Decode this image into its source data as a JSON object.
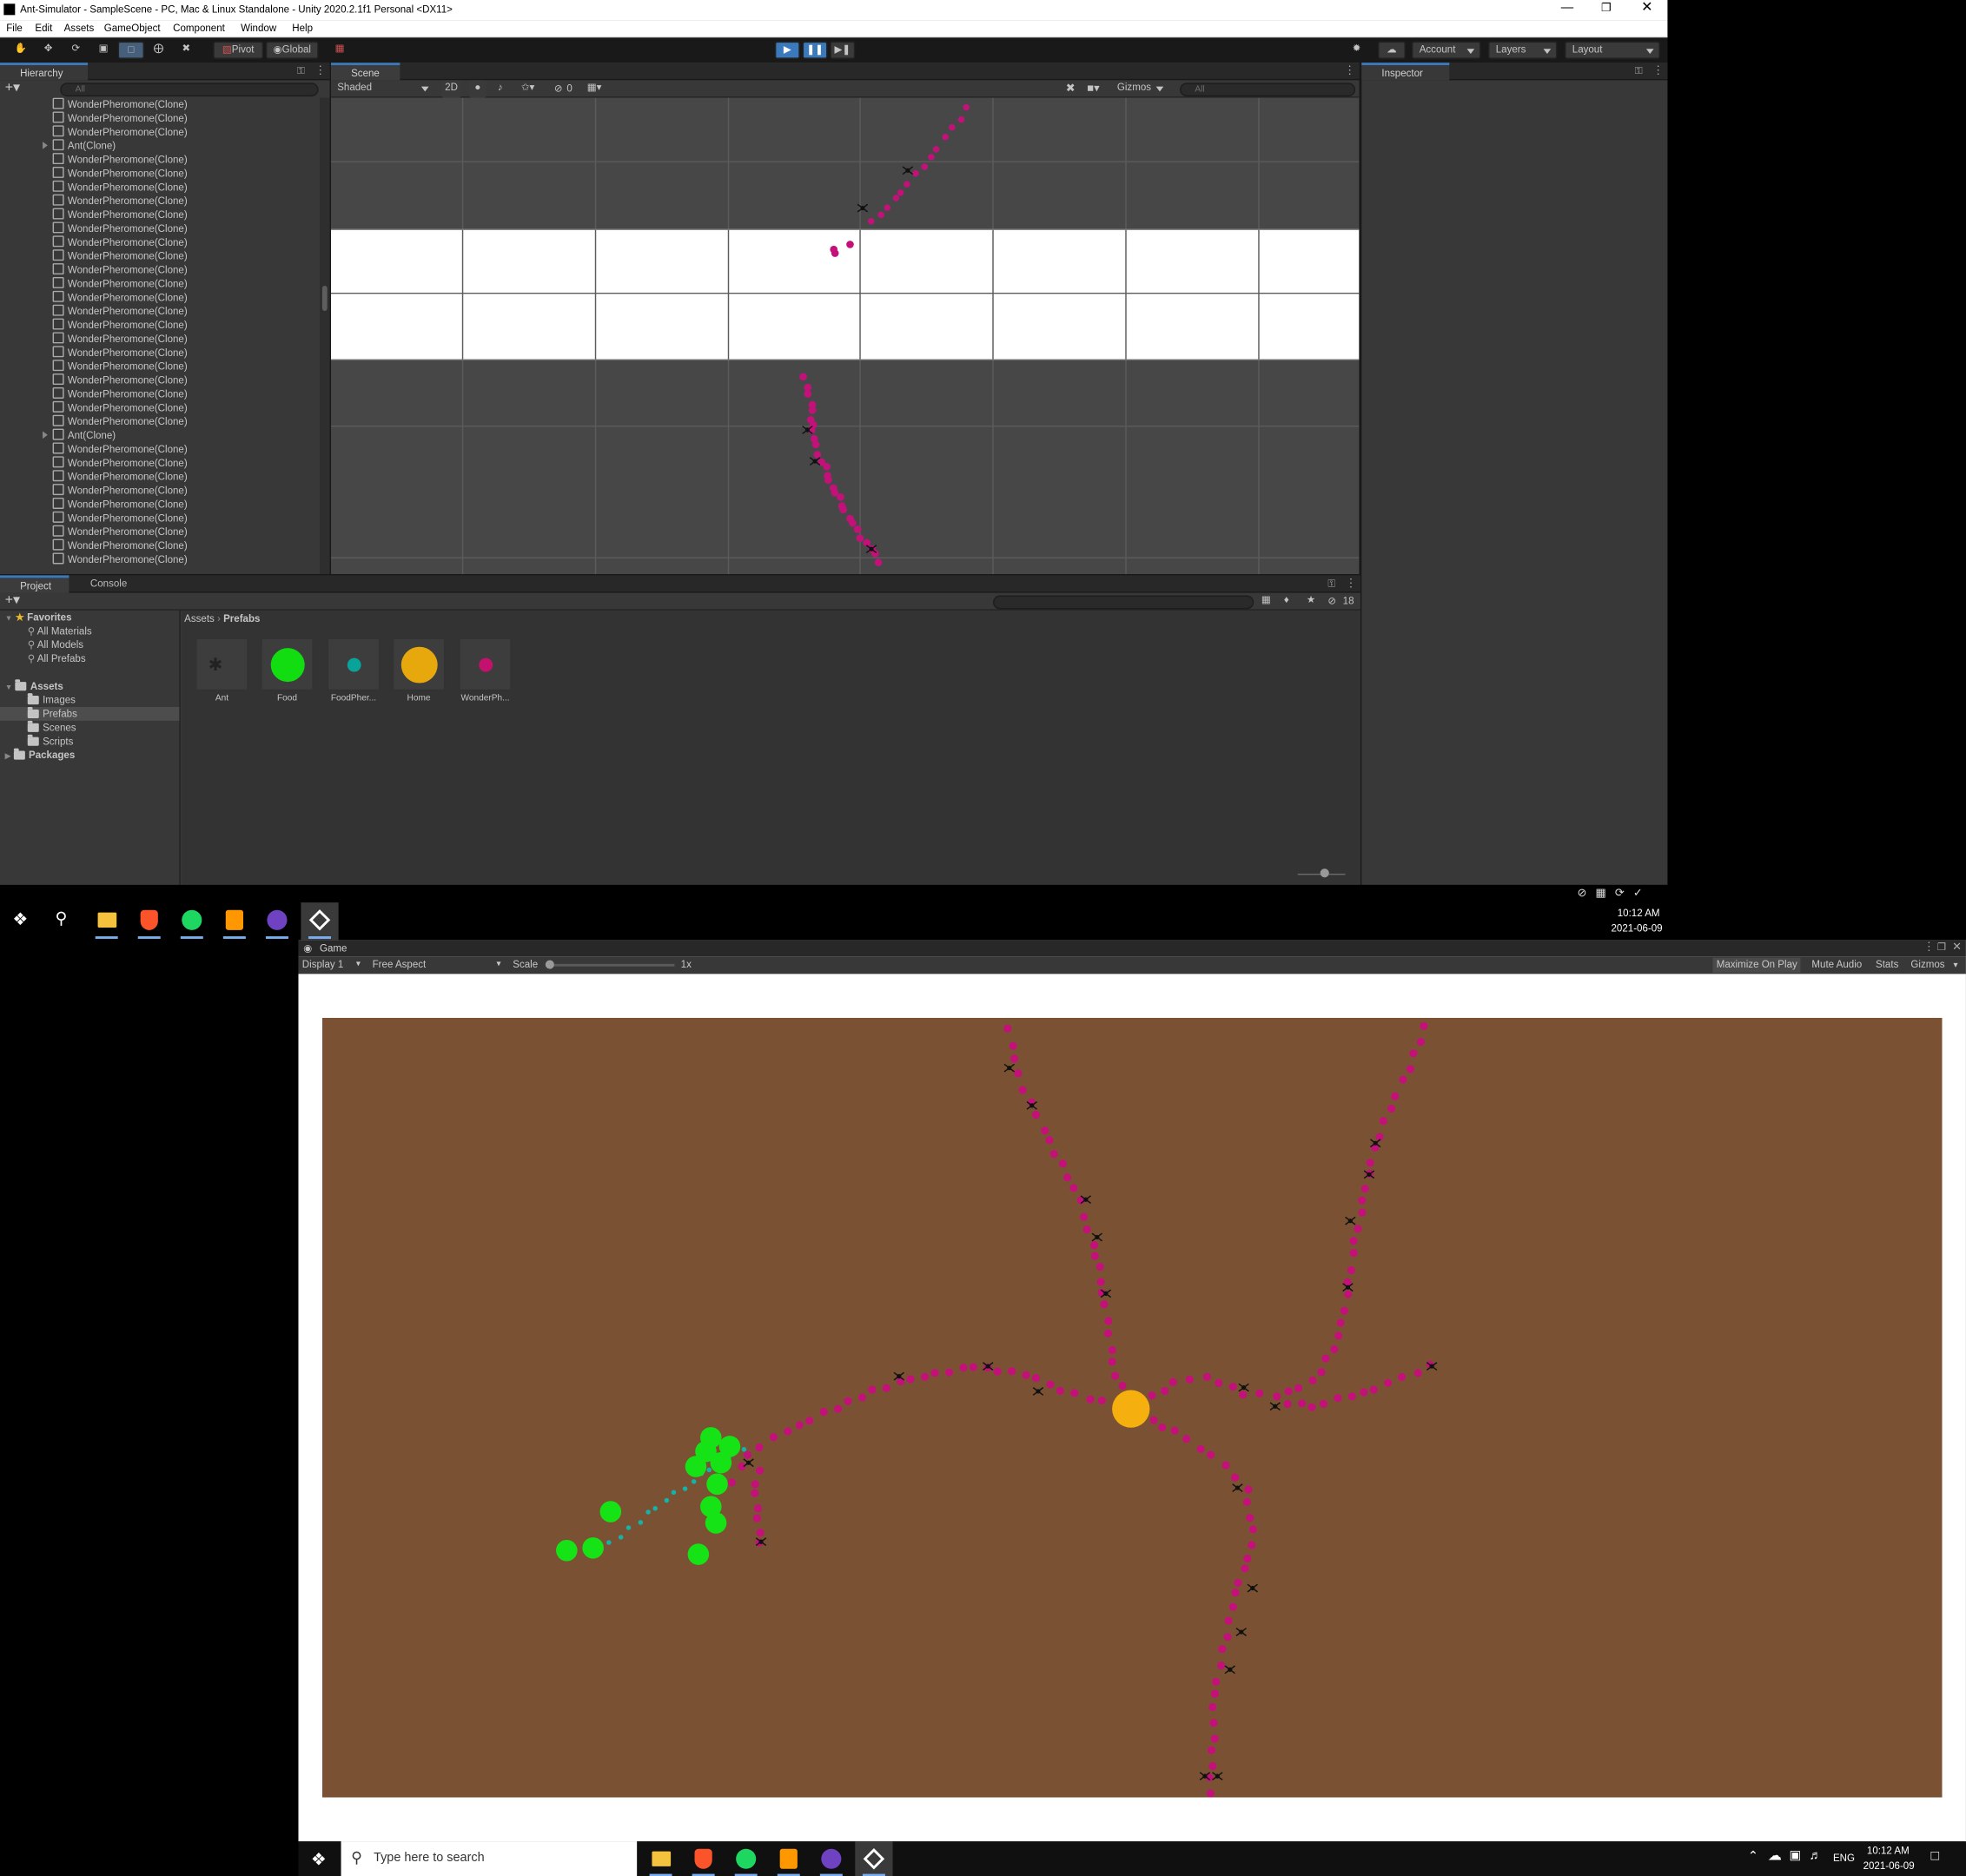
{
  "window": {
    "title": "Ant-Simulator - SampleScene - PC, Mac & Linux Standalone - Unity 2020.2.1f1 Personal <DX11>"
  },
  "menu": [
    "File",
    "Edit",
    "Assets",
    "GameObject",
    "Component",
    "Window",
    "Help"
  ],
  "toolbar": {
    "pivot": "Pivot",
    "global": "Global",
    "account": "Account",
    "layers": "Layers",
    "layout": "Layout"
  },
  "hierarchy": {
    "tab": "Hierarchy",
    "search_placeholder": "All",
    "rows": [
      "WonderPheromone(Clone)",
      "WonderPheromone(Clone)",
      "WonderPheromone(Clone)",
      "Ant(Clone)",
      "WonderPheromone(Clone)",
      "WonderPheromone(Clone)",
      "WonderPheromone(Clone)",
      "WonderPheromone(Clone)",
      "WonderPheromone(Clone)",
      "WonderPheromone(Clone)",
      "WonderPheromone(Clone)",
      "WonderPheromone(Clone)",
      "WonderPheromone(Clone)",
      "WonderPheromone(Clone)",
      "WonderPheromone(Clone)",
      "WonderPheromone(Clone)",
      "WonderPheromone(Clone)",
      "WonderPheromone(Clone)",
      "WonderPheromone(Clone)",
      "WonderPheromone(Clone)",
      "WonderPheromone(Clone)",
      "WonderPheromone(Clone)",
      "WonderPheromone(Clone)",
      "WonderPheromone(Clone)",
      "Ant(Clone)",
      "WonderPheromone(Clone)",
      "WonderPheromone(Clone)",
      "WonderPheromone(Clone)",
      "WonderPheromone(Clone)",
      "WonderPheromone(Clone)",
      "WonderPheromone(Clone)",
      "WonderPheromone(Clone)",
      "WonderPheromone(Clone)",
      "WonderPheromone(Clone)"
    ]
  },
  "scene": {
    "tab": "Scene",
    "shading": "Shaded",
    "mode_2d": "2D",
    "hidden_count": "0",
    "gizmos": "Gizmos",
    "search_placeholder": "All"
  },
  "inspector": {
    "tab": "Inspector"
  },
  "project": {
    "tab_project": "Project",
    "tab_console": "Console",
    "favorites": "Favorites",
    "favorite_items": [
      "All Materials",
      "All Models",
      "All Prefabs"
    ],
    "assets": "Assets",
    "asset_folders": [
      "Images",
      "Prefabs",
      "Scenes",
      "Scripts"
    ],
    "packages": "Packages",
    "breadcrumb_root": "Assets",
    "breadcrumb_current": "Prefabs",
    "hidden_count": "18",
    "prefabs": [
      {
        "name": "Ant",
        "icon": "ant-icon"
      },
      {
        "name": "Food",
        "color": "#11dd11"
      },
      {
        "name": "FoodPher...",
        "color": "#0aa39a"
      },
      {
        "name": "Home",
        "color": "#e6a80c"
      },
      {
        "name": "WonderPh...",
        "color": "#c4116e"
      }
    ]
  },
  "taskbar_top": {
    "time": "10:12 AM",
    "date": "2021-06-09"
  },
  "game": {
    "tab": "Game",
    "display": "Display 1",
    "aspect": "Free Aspect",
    "scale_label": "Scale",
    "scale_value": "1x",
    "maximize": "Maximize On Play",
    "mute": "Mute Audio",
    "stats": "Stats",
    "gizmos": "Gizmos"
  },
  "taskbar_bottom": {
    "search_placeholder": "Type here to search",
    "lang": "ENG",
    "time": "10:12 AM",
    "date": "2021-06-09"
  },
  "colors": {
    "ground": "#7a5233",
    "pheromone": "#c4117a",
    "food": "#16e316",
    "food_pheromone": "#14b3aa",
    "home": "#f5b00f",
    "unity_blue": "#3a79bb"
  }
}
